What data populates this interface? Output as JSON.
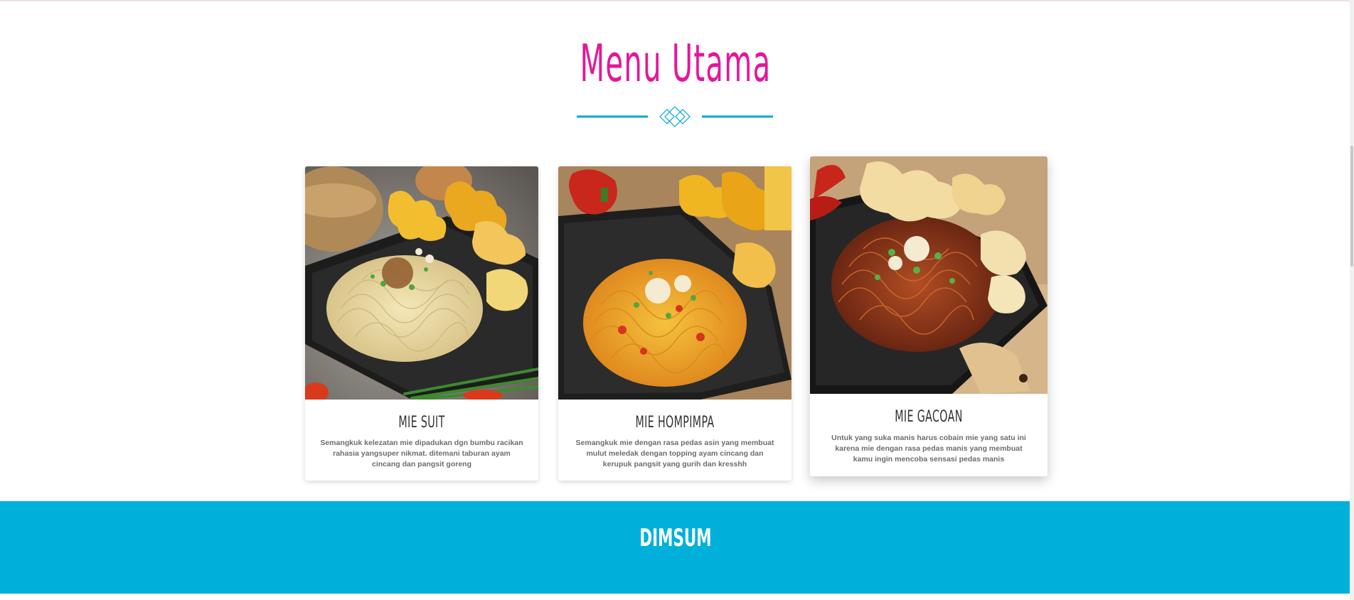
{
  "section": {
    "title": "Menu Utama"
  },
  "colors": {
    "title_pink": "#e3179a",
    "accent_blue": "#00b0db",
    "card_text": "#333333",
    "desc_text": "#6d6d6d"
  },
  "icons": {
    "divider": "diamond-ornament-icon"
  },
  "cards": [
    {
      "name": "MIE SUIT",
      "description": "Semangkuk kelezatan mie dipadukan dgn bumbu racikan rahasia yangsuper nikmat. ditemani taburan ayam cincang dan pangsit goreng",
      "image": "plain noodle dish with fried dumplings"
    },
    {
      "name": "MIE HOMPIMPA",
      "description": "Semangkuk mie dengan rasa pedas asin yang membuat mulut meledak dengan topping ayam cincang dan kerupuk pangsit yang gurih dan kresshh",
      "image": "spicy savory noodle dish with chili"
    },
    {
      "name": "MIE GACOAN",
      "description": "Untuk yang suka manis harus cobain mie yang satu ini karena mie dengan rasa pedas manis yang membuat kamu ingin mencoba sensasi pedas manis",
      "image": "sweet spicy noodle dish with crackers"
    }
  ],
  "next_section": {
    "title": "DIMSUM"
  }
}
